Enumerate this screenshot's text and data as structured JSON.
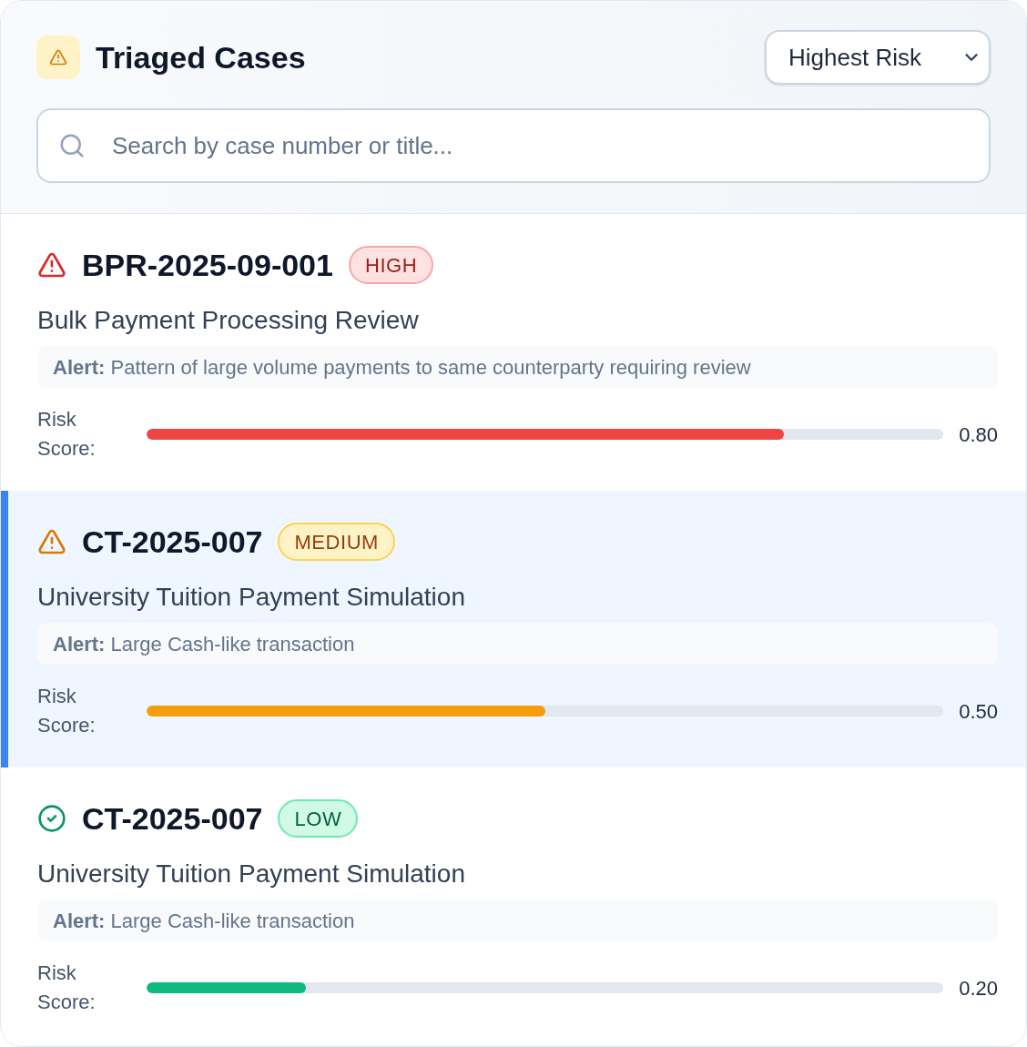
{
  "header": {
    "title": "Triaged Cases",
    "sort": {
      "value": "Highest Risk"
    }
  },
  "search": {
    "placeholder": "Search by case number or title..."
  },
  "cases": [
    {
      "kind": "high",
      "id": "BPR-2025-09-001",
      "badge": "HIGH",
      "title": "Bulk Payment Processing Review",
      "alert": "**Alert:** Pattern of large volume payments to same counterparty requiring review",
      "score_label": "Risk Score:",
      "level": 0.8,
      "score": "0.80",
      "selected": false
    },
    {
      "kind": "medium",
      "id": "CT-2025-007",
      "badge": "MEDIUM",
      "title": "University Tuition Payment Simulation",
      "alert": "**Alert:** Large Cash-like transaction",
      "score_label": "Risk Score:",
      "level": 0.5,
      "score": "0.50",
      "selected": true
    },
    {
      "kind": "low",
      "id": "CT-2025-007",
      "badge": "LOW",
      "title": "University Tuition Payment Simulation",
      "alert": "**Alert:** Large Cash-like transaction",
      "score_label": "Risk Score:",
      "level": 0.2,
      "score": "0.20",
      "selected": false
    }
  ]
}
